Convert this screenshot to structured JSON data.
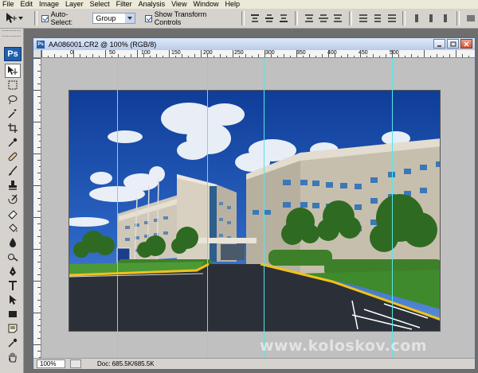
{
  "menu": [
    "File",
    "Edit",
    "Image",
    "Layer",
    "Select",
    "Filter",
    "Analysis",
    "View",
    "Window",
    "Help"
  ],
  "options": {
    "auto_select_label": "Auto-Select:",
    "auto_select_checked": true,
    "group_value": "Group",
    "show_transform_label": "Show Transform Controls",
    "show_transform_checked": true
  },
  "toolbox": {
    "logo": "Ps"
  },
  "document": {
    "title": "AA086001.CR2 @ 100% (RGB/8)",
    "ruler_labels": [
      "0",
      "50",
      "100",
      "150",
      "200",
      "250",
      "300",
      "350",
      "400",
      "450",
      "500"
    ],
    "zoom": "100%",
    "doc_size": "Doc: 685.5K/685.5K",
    "doc_icon": "Ps"
  },
  "watermark": "www.koloskov.com",
  "colors": {
    "guide": "#55e7e7",
    "sky": "#1e4ea8",
    "title_bar": "#b9cbe8"
  }
}
